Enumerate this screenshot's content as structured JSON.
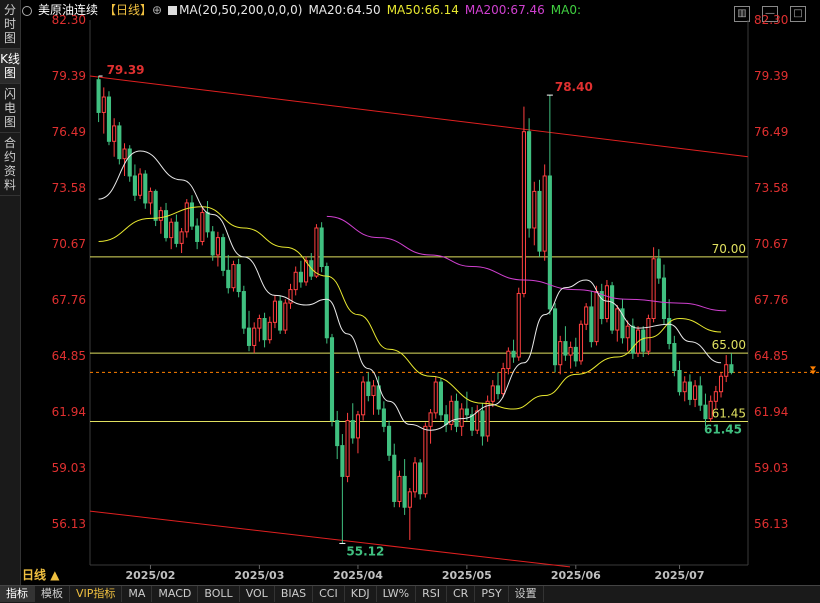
{
  "sidebar": {
    "tabs": [
      {
        "label": "分时图",
        "active": false
      },
      {
        "label": "K线图",
        "active": true
      },
      {
        "label": "闪电图",
        "active": false
      },
      {
        "label": "合约资料",
        "active": false
      }
    ]
  },
  "header": {
    "instrument": "美原油连续",
    "period_bracket": "【日线】",
    "ma_params": "MA(20,50,200,0,0,0)",
    "ma20": "MA20:64.50",
    "ma50": "MA50:66.14",
    "ma200": "MA200:67.46",
    "ma0": "MA0:"
  },
  "colors": {
    "up": "#ff4040",
    "down": "#40c080",
    "ma20": "#e8e8e8",
    "ma50": "#e8e830",
    "ma200": "#d040d0",
    "trendline": "#e02020",
    "hline": "#e0e060",
    "last_price": "#ff8000",
    "axis_text": "#e03030",
    "date_text": "#c0c0c0"
  },
  "period_button": "日线",
  "bottom_tabs": [
    "指标",
    "模板",
    "VIP指标",
    "MA",
    "MACD",
    "BOLL",
    "VOL",
    "BIAS",
    "CCI",
    "KDJ",
    "LW%",
    "RSI",
    "CR",
    "PSY",
    "设置"
  ],
  "chart_data": {
    "type": "candlestick",
    "y_ticks": [
      "82.30",
      "79.39",
      "76.49",
      "73.58",
      "70.67",
      "67.76",
      "64.85",
      "61.94",
      "59.03",
      "56.13"
    ],
    "ylim": [
      54.0,
      82.3
    ],
    "x_ticks": [
      "2025/02",
      "2025/03",
      "2025/04",
      "2025/05",
      "2025/06",
      "2025/07"
    ],
    "annotations": {
      "high_label": "79.39",
      "peak_label": "78.40",
      "low_label": "55.12",
      "hline_labels": [
        "70.00",
        "65.00",
        "61.45"
      ],
      "hline_low_label": "61.45"
    },
    "hlines": [
      70.0,
      65.0,
      61.45
    ],
    "last_price": 64.0,
    "candles": [
      {
        "o": 79.2,
        "h": 79.39,
        "l": 77.0,
        "c": 77.5
      },
      {
        "o": 77.5,
        "h": 78.8,
        "l": 76.4,
        "c": 78.3
      },
      {
        "o": 78.3,
        "h": 78.6,
        "l": 75.8,
        "c": 76.0
      },
      {
        "o": 76.0,
        "h": 77.2,
        "l": 75.2,
        "c": 76.8
      },
      {
        "o": 76.8,
        "h": 77.0,
        "l": 74.8,
        "c": 75.1
      },
      {
        "o": 75.1,
        "h": 75.9,
        "l": 74.2,
        "c": 75.6
      },
      {
        "o": 75.6,
        "h": 75.8,
        "l": 73.9,
        "c": 74.2
      },
      {
        "o": 74.2,
        "h": 74.8,
        "l": 72.9,
        "c": 73.2
      },
      {
        "o": 73.2,
        "h": 74.6,
        "l": 73.0,
        "c": 74.3
      },
      {
        "o": 74.3,
        "h": 74.5,
        "l": 72.5,
        "c": 72.8
      },
      {
        "o": 72.8,
        "h": 73.6,
        "l": 72.2,
        "c": 73.4
      },
      {
        "o": 73.4,
        "h": 73.5,
        "l": 71.6,
        "c": 71.9
      },
      {
        "o": 71.9,
        "h": 72.6,
        "l": 71.2,
        "c": 72.4
      },
      {
        "o": 72.4,
        "h": 72.8,
        "l": 70.8,
        "c": 71.0
      },
      {
        "o": 71.0,
        "h": 72.0,
        "l": 70.4,
        "c": 71.8
      },
      {
        "o": 71.8,
        "h": 72.2,
        "l": 70.5,
        "c": 70.7
      },
      {
        "o": 70.7,
        "h": 71.5,
        "l": 70.2,
        "c": 71.3
      },
      {
        "o": 71.3,
        "h": 73.0,
        "l": 71.0,
        "c": 72.8
      },
      {
        "o": 72.8,
        "h": 73.2,
        "l": 71.4,
        "c": 71.6
      },
      {
        "o": 71.6,
        "h": 72.0,
        "l": 70.4,
        "c": 70.8
      },
      {
        "o": 70.8,
        "h": 72.6,
        "l": 70.6,
        "c": 72.3
      },
      {
        "o": 72.3,
        "h": 72.9,
        "l": 71.0,
        "c": 71.3
      },
      {
        "o": 71.3,
        "h": 71.6,
        "l": 69.8,
        "c": 70.1
      },
      {
        "o": 70.1,
        "h": 71.3,
        "l": 69.5,
        "c": 71.0
      },
      {
        "o": 71.0,
        "h": 71.2,
        "l": 69.0,
        "c": 69.3
      },
      {
        "o": 69.3,
        "h": 70.1,
        "l": 68.1,
        "c": 68.4
      },
      {
        "o": 68.4,
        "h": 69.8,
        "l": 68.2,
        "c": 69.6
      },
      {
        "o": 69.6,
        "h": 69.9,
        "l": 67.9,
        "c": 68.2
      },
      {
        "o": 68.2,
        "h": 68.5,
        "l": 66.0,
        "c": 66.3
      },
      {
        "o": 66.3,
        "h": 67.2,
        "l": 65.1,
        "c": 65.4
      },
      {
        "o": 65.4,
        "h": 66.6,
        "l": 65.0,
        "c": 66.3
      },
      {
        "o": 66.3,
        "h": 67.0,
        "l": 65.6,
        "c": 66.8
      },
      {
        "o": 66.8,
        "h": 67.1,
        "l": 65.3,
        "c": 65.7
      },
      {
        "o": 65.7,
        "h": 66.9,
        "l": 65.5,
        "c": 66.6
      },
      {
        "o": 66.6,
        "h": 68.0,
        "l": 66.3,
        "c": 67.7
      },
      {
        "o": 67.7,
        "h": 68.0,
        "l": 66.0,
        "c": 66.2
      },
      {
        "o": 66.2,
        "h": 67.8,
        "l": 66.0,
        "c": 67.6
      },
      {
        "o": 67.6,
        "h": 68.6,
        "l": 67.3,
        "c": 68.3
      },
      {
        "o": 68.3,
        "h": 69.5,
        "l": 68.0,
        "c": 69.2
      },
      {
        "o": 69.2,
        "h": 69.8,
        "l": 68.4,
        "c": 68.7
      },
      {
        "o": 68.7,
        "h": 70.0,
        "l": 68.5,
        "c": 69.8
      },
      {
        "o": 69.8,
        "h": 70.2,
        "l": 68.8,
        "c": 69.0
      },
      {
        "o": 69.0,
        "h": 71.7,
        "l": 68.9,
        "c": 71.5
      },
      {
        "o": 71.5,
        "h": 71.8,
        "l": 69.2,
        "c": 69.5
      },
      {
        "o": 69.5,
        "h": 69.7,
        "l": 65.5,
        "c": 65.8
      },
      {
        "o": 65.8,
        "h": 66.0,
        "l": 61.2,
        "c": 61.5
      },
      {
        "o": 61.5,
        "h": 62.0,
        "l": 59.5,
        "c": 60.2
      },
      {
        "o": 60.2,
        "h": 60.8,
        "l": 55.12,
        "c": 58.6
      },
      {
        "o": 58.6,
        "h": 61.9,
        "l": 58.3,
        "c": 61.5
      },
      {
        "o": 61.5,
        "h": 62.4,
        "l": 60.3,
        "c": 60.6
      },
      {
        "o": 60.6,
        "h": 62.0,
        "l": 59.8,
        "c": 61.8
      },
      {
        "o": 61.8,
        "h": 63.8,
        "l": 61.5,
        "c": 63.5
      },
      {
        "o": 63.5,
        "h": 64.0,
        "l": 62.5,
        "c": 62.8
      },
      {
        "o": 62.8,
        "h": 63.6,
        "l": 61.8,
        "c": 63.3
      },
      {
        "o": 63.3,
        "h": 63.8,
        "l": 61.8,
        "c": 62.1
      },
      {
        "o": 62.1,
        "h": 62.5,
        "l": 60.9,
        "c": 61.2
      },
      {
        "o": 61.2,
        "h": 61.5,
        "l": 59.4,
        "c": 59.7
      },
      {
        "o": 59.7,
        "h": 60.3,
        "l": 57.0,
        "c": 57.3
      },
      {
        "o": 57.3,
        "h": 58.9,
        "l": 57.0,
        "c": 58.6
      },
      {
        "o": 58.6,
        "h": 59.5,
        "l": 56.6,
        "c": 57.0
      },
      {
        "o": 57.0,
        "h": 58.0,
        "l": 55.3,
        "c": 57.8
      },
      {
        "o": 57.8,
        "h": 59.6,
        "l": 57.5,
        "c": 59.3
      },
      {
        "o": 59.3,
        "h": 59.5,
        "l": 57.4,
        "c": 57.7
      },
      {
        "o": 57.7,
        "h": 61.4,
        "l": 57.5,
        "c": 61.2
      },
      {
        "o": 61.2,
        "h": 62.1,
        "l": 60.3,
        "c": 61.9
      },
      {
        "o": 61.9,
        "h": 63.8,
        "l": 61.6,
        "c": 63.5
      },
      {
        "o": 63.5,
        "h": 63.7,
        "l": 61.5,
        "c": 61.8
      },
      {
        "o": 61.8,
        "h": 62.3,
        "l": 60.9,
        "c": 61.3
      },
      {
        "o": 61.3,
        "h": 62.8,
        "l": 61.0,
        "c": 62.5
      },
      {
        "o": 62.5,
        "h": 62.9,
        "l": 60.9,
        "c": 61.2
      },
      {
        "o": 61.2,
        "h": 62.4,
        "l": 60.7,
        "c": 62.1
      },
      {
        "o": 62.1,
        "h": 63.0,
        "l": 61.5,
        "c": 61.8
      },
      {
        "o": 61.8,
        "h": 62.2,
        "l": 60.7,
        "c": 61.0
      },
      {
        "o": 61.0,
        "h": 62.3,
        "l": 60.8,
        "c": 62.0
      },
      {
        "o": 62.0,
        "h": 62.4,
        "l": 60.2,
        "c": 60.7
      },
      {
        "o": 60.7,
        "h": 62.8,
        "l": 60.4,
        "c": 62.5
      },
      {
        "o": 62.5,
        "h": 63.6,
        "l": 62.2,
        "c": 63.3
      },
      {
        "o": 63.3,
        "h": 64.0,
        "l": 62.6,
        "c": 62.9
      },
      {
        "o": 62.9,
        "h": 64.5,
        "l": 62.7,
        "c": 64.2
      },
      {
        "o": 64.2,
        "h": 65.3,
        "l": 63.9,
        "c": 65.1
      },
      {
        "o": 65.1,
        "h": 65.7,
        "l": 64.5,
        "c": 64.8
      },
      {
        "o": 64.8,
        "h": 68.4,
        "l": 64.6,
        "c": 68.1
      },
      {
        "o": 68.1,
        "h": 77.8,
        "l": 67.9,
        "c": 76.5
      },
      {
        "o": 76.5,
        "h": 77.2,
        "l": 71.0,
        "c": 71.5
      },
      {
        "o": 71.5,
        "h": 73.9,
        "l": 70.6,
        "c": 73.4
      },
      {
        "o": 73.4,
        "h": 74.0,
        "l": 70.0,
        "c": 70.3
      },
      {
        "o": 70.3,
        "h": 74.8,
        "l": 69.8,
        "c": 74.2
      },
      {
        "o": 74.2,
        "h": 78.4,
        "l": 67.0,
        "c": 67.3
      },
      {
        "o": 67.3,
        "h": 67.6,
        "l": 64.0,
        "c": 64.4
      },
      {
        "o": 64.4,
        "h": 65.9,
        "l": 63.9,
        "c": 65.6
      },
      {
        "o": 65.6,
        "h": 66.4,
        "l": 64.6,
        "c": 64.9
      },
      {
        "o": 64.9,
        "h": 65.6,
        "l": 64.2,
        "c": 65.3
      },
      {
        "o": 65.3,
        "h": 65.8,
        "l": 64.3,
        "c": 64.6
      },
      {
        "o": 64.6,
        "h": 66.7,
        "l": 64.4,
        "c": 66.5
      },
      {
        "o": 66.5,
        "h": 67.6,
        "l": 66.2,
        "c": 67.4
      },
      {
        "o": 67.4,
        "h": 68.2,
        "l": 65.3,
        "c": 65.6
      },
      {
        "o": 65.6,
        "h": 68.5,
        "l": 65.4,
        "c": 68.2
      },
      {
        "o": 68.2,
        "h": 68.6,
        "l": 66.5,
        "c": 66.8
      },
      {
        "o": 66.8,
        "h": 68.8,
        "l": 66.6,
        "c": 68.5
      },
      {
        "o": 68.5,
        "h": 68.7,
        "l": 66.0,
        "c": 66.2
      },
      {
        "o": 66.2,
        "h": 67.5,
        "l": 65.6,
        "c": 67.3
      },
      {
        "o": 67.3,
        "h": 67.8,
        "l": 65.5,
        "c": 65.8
      },
      {
        "o": 65.8,
        "h": 66.7,
        "l": 65.1,
        "c": 66.4
      },
      {
        "o": 66.4,
        "h": 66.8,
        "l": 64.7,
        "c": 65.0
      },
      {
        "o": 65.0,
        "h": 66.4,
        "l": 64.8,
        "c": 66.2
      },
      {
        "o": 66.2,
        "h": 66.4,
        "l": 64.8,
        "c": 65.1
      },
      {
        "o": 65.1,
        "h": 67.0,
        "l": 64.9,
        "c": 66.8
      },
      {
        "o": 66.8,
        "h": 70.5,
        "l": 66.6,
        "c": 69.9
      },
      {
        "o": 69.9,
        "h": 70.4,
        "l": 68.6,
        "c": 68.9
      },
      {
        "o": 68.9,
        "h": 69.6,
        "l": 66.5,
        "c": 66.8
      },
      {
        "o": 66.8,
        "h": 67.8,
        "l": 65.2,
        "c": 65.5
      },
      {
        "o": 65.5,
        "h": 65.9,
        "l": 63.8,
        "c": 64.1
      },
      {
        "o": 64.1,
        "h": 64.6,
        "l": 62.8,
        "c": 63.0
      },
      {
        "o": 63.0,
        "h": 63.8,
        "l": 62.5,
        "c": 63.5
      },
      {
        "o": 63.5,
        "h": 63.9,
        "l": 62.3,
        "c": 62.6
      },
      {
        "o": 62.6,
        "h": 63.6,
        "l": 62.2,
        "c": 63.3
      },
      {
        "o": 63.3,
        "h": 63.8,
        "l": 62.0,
        "c": 62.3
      },
      {
        "o": 62.3,
        "h": 62.9,
        "l": 61.2,
        "c": 61.6
      },
      {
        "o": 61.6,
        "h": 62.8,
        "l": 61.45,
        "c": 62.5
      },
      {
        "o": 62.5,
        "h": 63.3,
        "l": 62.1,
        "c": 63.0
      },
      {
        "o": 63.0,
        "h": 64.0,
        "l": 62.7,
        "c": 63.8
      },
      {
        "o": 63.8,
        "h": 64.9,
        "l": 63.5,
        "c": 64.4
      },
      {
        "o": 64.4,
        "h": 65.0,
        "l": 63.9,
        "c": 64.0
      }
    ],
    "ma20": [
      [
        0,
        73.0
      ],
      [
        8,
        75.5
      ],
      [
        16,
        74.0
      ],
      [
        22,
        72.2
      ],
      [
        28,
        70.0
      ],
      [
        34,
        68.0
      ],
      [
        40,
        67.5
      ],
      [
        44,
        67.8
      ],
      [
        48,
        66.0
      ],
      [
        52,
        64.2
      ],
      [
        56,
        62.5
      ],
      [
        60,
        61.3
      ],
      [
        64,
        61.0
      ],
      [
        70,
        61.6
      ],
      [
        76,
        62.3
      ],
      [
        82,
        64.5
      ],
      [
        86,
        67.0
      ],
      [
        90,
        68.4
      ],
      [
        94,
        68.8
      ],
      [
        98,
        67.7
      ],
      [
        104,
        66.3
      ],
      [
        110,
        66.5
      ],
      [
        114,
        65.6
      ],
      [
        120,
        64.5
      ]
    ],
    "ma50": [
      [
        0,
        70.8
      ],
      [
        10,
        72.0
      ],
      [
        20,
        72.6
      ],
      [
        28,
        71.5
      ],
      [
        36,
        70.5
      ],
      [
        44,
        69.0
      ],
      [
        50,
        67.0
      ],
      [
        56,
        65.2
      ],
      [
        64,
        63.8
      ],
      [
        74,
        62.4
      ],
      [
        80,
        62.1
      ],
      [
        86,
        62.8
      ],
      [
        92,
        63.9
      ],
      [
        100,
        64.8
      ],
      [
        106,
        65.8
      ],
      [
        112,
        66.8
      ],
      [
        120,
        66.1
      ]
    ],
    "ma200": [
      [
        44,
        72.1
      ],
      [
        54,
        71.0
      ],
      [
        64,
        70.1
      ],
      [
        72,
        69.5
      ],
      [
        82,
        68.8
      ],
      [
        92,
        68.3
      ],
      [
        102,
        67.8
      ],
      [
        112,
        67.6
      ],
      [
        121,
        67.2
      ]
    ]
  }
}
